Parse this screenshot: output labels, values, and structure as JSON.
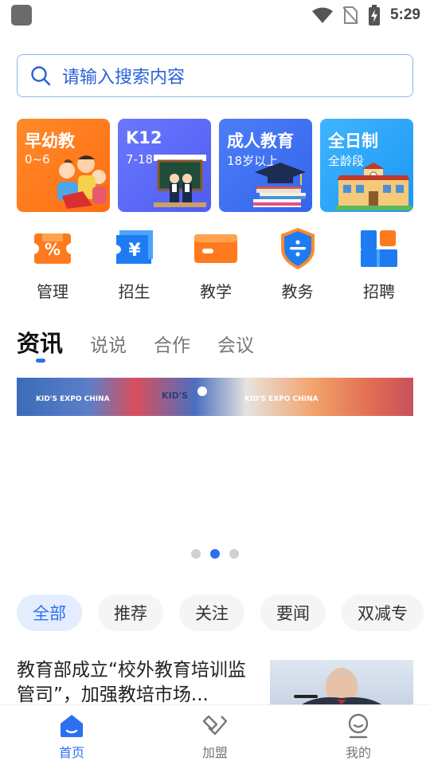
{
  "status_bar": {
    "time": "5:29",
    "icons": [
      "wifi-icon",
      "no-sim-icon",
      "battery-charging-icon"
    ]
  },
  "search": {
    "placeholder": "请输入搜索内容",
    "icon": "search-icon"
  },
  "categories": [
    {
      "title": "早幼教",
      "subtitle": "0~6",
      "color": "#ff7a1e"
    },
    {
      "title": "K12",
      "subtitle": "7-18",
      "color": "#5a68f7"
    },
    {
      "title": "成人教育",
      "subtitle": "18岁以上",
      "color": "#3e70ef"
    },
    {
      "title": "全日制",
      "subtitle": "全龄段",
      "color": "#28a5f8"
    }
  ],
  "quick_actions": [
    {
      "label": "管理",
      "icon": "percent-ticket-icon"
    },
    {
      "label": "招生",
      "icon": "yen-ticket-icon"
    },
    {
      "label": "教学",
      "icon": "card-icon"
    },
    {
      "label": "教务",
      "icon": "shield-divide-icon"
    },
    {
      "label": "招聘",
      "icon": "grid-blocks-icon"
    }
  ],
  "news_tabs": [
    {
      "label": "资讯",
      "active": true
    },
    {
      "label": "说说",
      "active": false
    },
    {
      "label": "合作",
      "active": false
    },
    {
      "label": "会议",
      "active": false
    }
  ],
  "banner": {
    "tag_left": "KID'S EXPO CHINA",
    "tag_right": "KID'S EXPO CHINA",
    "logo": "KID'S",
    "dots_total": 3,
    "dots_active_index": 1
  },
  "filter_chips": [
    {
      "label": "全部",
      "active": true
    },
    {
      "label": "推荐",
      "active": false
    },
    {
      "label": "关注",
      "active": false
    },
    {
      "label": "要闻",
      "active": false
    },
    {
      "label": "双减专",
      "active": false
    }
  ],
  "article": {
    "title": "教育部成立“校外教育培训监管司”，加强教培市场..."
  },
  "bottom_nav": [
    {
      "label": "首页",
      "icon": "home-icon",
      "active": true
    },
    {
      "label": "加盟",
      "icon": "handshake-icon",
      "active": false
    },
    {
      "label": "我的",
      "icon": "profile-icon",
      "active": false
    }
  ],
  "colors": {
    "accent": "#2e6ff2",
    "search_border": "#8fb4ee"
  }
}
